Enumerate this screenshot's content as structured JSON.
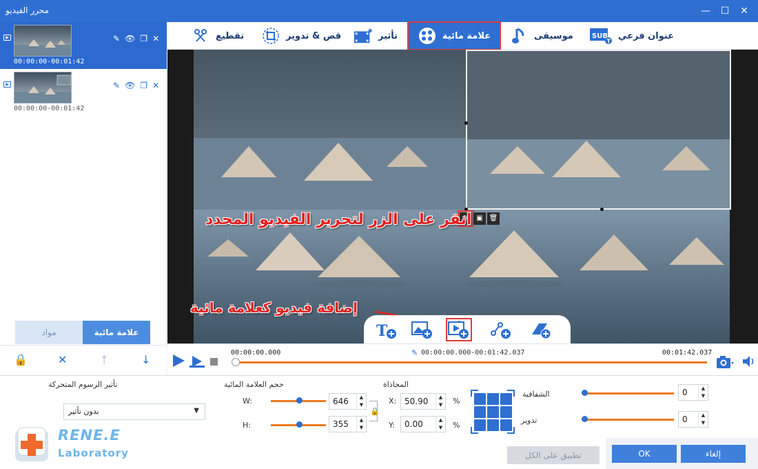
{
  "window": {
    "title": "محرر الفيديو",
    "minimize": "—",
    "maximize": "☐",
    "close": "✕"
  },
  "clips": [
    {
      "time": "00:00:00-00:01:42",
      "selected": true
    },
    {
      "time": "00:00:00-00:01:42",
      "selected": false
    }
  ],
  "left_tabs": {
    "watermark": "علامة مائية",
    "materials": "مواد"
  },
  "toolbar": {
    "subtitle": "عنوان فرعي",
    "music": "موسيقى",
    "watermark": "علامة مائية",
    "effect": "تأثير",
    "crop_rotate": "قص & تدوير",
    "trim": "تقطيع"
  },
  "annotations": {
    "edit_hint": "انقر على الزر لتحرير الفيديو المحدد",
    "add_video_hint": "إضافة فيديو كعلامة مائية"
  },
  "timeline": {
    "start": "00:00:00.000",
    "range": "00:00:00.000-00:01:42.037",
    "end": "00:01:42.037",
    "progress": 0
  },
  "bottom": {
    "animation_effect_label": "تأثير الرسوم المتحركة",
    "animation_effect_value": "بدون تأثير",
    "watermark_size_label": "حجم العلامة المائية",
    "w_label": "W:",
    "w_value": "646",
    "h_label": "H:",
    "h_value": "355",
    "alignment_label": "المحاذاة",
    "x_label": "X:",
    "x_value": "50.90",
    "y_label": "Y:",
    "y_value": "0.00",
    "percent": "%",
    "transparency_label": "الشفافية",
    "transparency_value": "0",
    "rotate_label": "تدوير",
    "rotate_value": "0",
    "apply_all": "تطبيق على الكل",
    "ok": "OK",
    "cancel": "إلغاء"
  },
  "logo": {
    "line1": "RENE.E",
    "line2": "Laboratory"
  },
  "colors": {
    "accent": "#2e6fd1",
    "highlight": "#e23b3b",
    "track": "#ee7a1e",
    "annotation": "#e42222"
  }
}
